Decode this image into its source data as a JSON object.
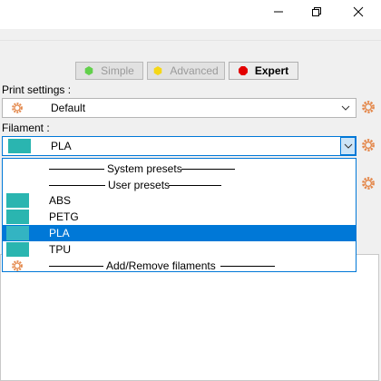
{
  "window_controls": {
    "maximize_icon": "restore-icon",
    "close_icon": "close-icon"
  },
  "modes": {
    "simple": {
      "label": "Simple",
      "color": "#62d04b"
    },
    "advanced": {
      "label": "Advanced",
      "color": "#f5d717"
    },
    "expert": {
      "label": "Expert",
      "color": "#e30000"
    }
  },
  "print_settings": {
    "label": "Print settings :",
    "value": "Default"
  },
  "filament": {
    "label": "Filament :",
    "value": "PLA",
    "swatch_color": "#2ab5b0",
    "dropdown": {
      "system_presets_label": "System presets",
      "user_presets_label": "User presets",
      "items": [
        "ABS",
        "PETG",
        "PLA",
        "TPU"
      ],
      "selected": "PLA",
      "add_remove_label": "Add/Remove filaments"
    }
  },
  "accent_color": "#0078d7"
}
